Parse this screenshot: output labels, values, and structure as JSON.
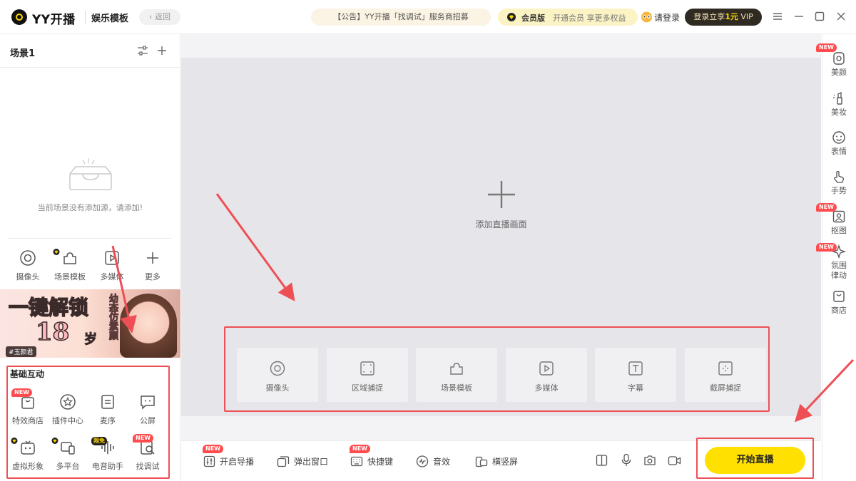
{
  "titlebar": {
    "brand": "YY开播",
    "mode": "娱乐模板",
    "back_label": "返回",
    "notice": "【公告】YY开播「找调试」服务商招募",
    "vip_title": "会员版",
    "vip_desc": "开通会员 享更多权益",
    "login_label": "请登录",
    "login_vip_prefix": "登录立享",
    "login_vip_amount": "1元",
    "login_vip_suffix": " VIP"
  },
  "scene": {
    "title": "场景1",
    "empty_text": "当前场景没有添加源，请添加!"
  },
  "tools": [
    {
      "label": "摄像头",
      "icon": "camera-icon"
    },
    {
      "label": "场景模板",
      "icon": "puzzle-icon",
      "vip": true
    },
    {
      "label": "多媒体",
      "icon": "media-icon"
    },
    {
      "label": "更多",
      "icon": "plus-icon"
    }
  ],
  "banner": {
    "headline": "一键解锁",
    "age": "18",
    "age_unit": "岁",
    "side_text": "幼态仿素颜",
    "tag": "#玉颜君"
  },
  "interact": {
    "title": "基础互动",
    "items": [
      {
        "label": "特效商店",
        "icon": "gift-bag-icon",
        "badge": "NEW"
      },
      {
        "label": "插件中心",
        "icon": "star-icon"
      },
      {
        "label": "麦序",
        "icon": "list-icon"
      },
      {
        "label": "公屏",
        "icon": "chat-icon"
      },
      {
        "label": "虚拟形象",
        "icon": "robot-icon",
        "vip": true
      },
      {
        "label": "多平台",
        "icon": "devices-icon",
        "vip": true
      },
      {
        "label": "电音助手",
        "icon": "waveform-icon",
        "badge": "限免"
      },
      {
        "label": "找调试",
        "icon": "search-doc-icon",
        "badge": "NEW"
      }
    ]
  },
  "stage": {
    "add_label": "添加直播画面",
    "sources": [
      {
        "label": "摄像头",
        "icon": "camera-icon"
      },
      {
        "label": "区域捕捉",
        "icon": "region-capture-icon"
      },
      {
        "label": "场景模板",
        "icon": "puzzle-icon"
      },
      {
        "label": "多媒体",
        "icon": "media-icon"
      },
      {
        "label": "字幕",
        "icon": "text-icon"
      },
      {
        "label": "截屏捕捉",
        "icon": "screen-capture-icon"
      }
    ]
  },
  "rail": [
    {
      "label": "美颜",
      "icon": "beauty-icon",
      "badge": "NEW"
    },
    {
      "label": "美妆",
      "icon": "makeup-icon"
    },
    {
      "label": "表情",
      "icon": "emoji-icon"
    },
    {
      "label": "手势",
      "icon": "gesture-icon"
    },
    {
      "label": "抠图",
      "icon": "cutout-icon",
      "badge": "NEW"
    },
    {
      "label": "氛围",
      "label2": "律动",
      "icon": "atmosphere-icon",
      "badge": "NEW"
    },
    {
      "label": "商店",
      "icon": "shop-icon"
    }
  ],
  "bottombar": {
    "items": [
      {
        "label": "开启导播",
        "icon": "director-icon",
        "badge": "NEW"
      },
      {
        "label": "弹出窗口",
        "icon": "popout-icon"
      },
      {
        "label": "快捷键",
        "icon": "keyboard-icon",
        "badge": "NEW"
      },
      {
        "label": "音效",
        "icon": "sound-effect-icon"
      },
      {
        "label": "横竖屏",
        "icon": "rotate-icon"
      }
    ],
    "start_label": "开始直播"
  },
  "colors": {
    "accent": "#ffe000",
    "annotation": "#ee4f55",
    "badge": "#ff4d4f"
  }
}
